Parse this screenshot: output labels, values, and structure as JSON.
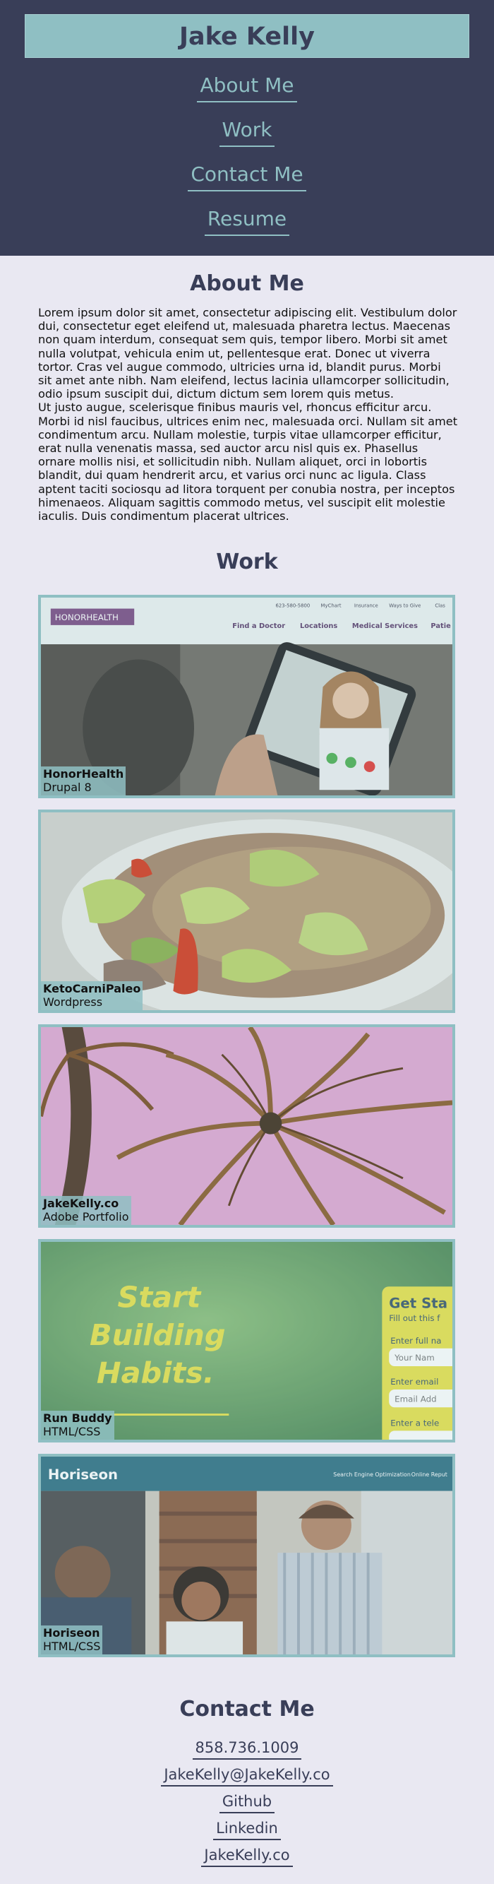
{
  "header": {
    "title": "Jake Kelly"
  },
  "nav": {
    "items": [
      {
        "label": "About Me"
      },
      {
        "label": "Work"
      },
      {
        "label": "Contact Me"
      },
      {
        "label": "Resume"
      }
    ]
  },
  "about": {
    "title": "About Me",
    "paragraph1": "Lorem ipsum dolor sit amet, consectetur adipiscing elit. Vestibulum dolor dui, consectetur eget eleifend ut, malesuada pharetra lectus. Maecenas non quam interdum, consequat sem quis, tempor libero. Morbi sit amet nulla volutpat, vehicula enim ut, pellentesque erat. Donec ut viverra tortor. Cras vel augue commodo, ultricies urna id, blandit purus. Morbi sit amet ante nibh. Nam eleifend, lectus lacinia ullamcorper sollicitudin, odio ipsum suscipit dui, dictum dictum sem lorem quis metus.",
    "paragraph2": "Ut justo augue, scelerisque finibus mauris vel, rhoncus efficitur arcu. Morbi id nisl faucibus, ultrices enim nec, malesuada orci. Nullam sit amet condimentum arcu. Nullam molestie, turpis vitae ullamcorper efficitur, erat nulla venenatis massa, sed auctor arcu nisl quis ex. Phasellus ornare mollis nisi, et sollicitudin nibh. Nullam aliquet, orci in lobortis blandit, dui quam hendrerit arcu, et varius orci nunc ac ligula. Class aptent taciti sociosqu ad litora torquent per conubia nostra, per inceptos himenaeos. Aliquam sagittis commodo metus, vel suscipit elit molestie iaculis. Duis condimentum placerat ultrices."
  },
  "work": {
    "title": "Work",
    "projects": [
      {
        "name": "HonorHealth",
        "tech": "Drupal 8",
        "screenshot": {
          "logo": "HONORHEALTH",
          "top_links": [
            "623-580-5800",
            "MyChart",
            "Insurance",
            "Ways to Give",
            "Clas"
          ],
          "menu": [
            "Find a Doctor",
            "Locations",
            "Medical Services",
            "Patie"
          ]
        }
      },
      {
        "name": "KetoCarniPaleo",
        "tech": "Wordpress"
      },
      {
        "name": "JakeKelly.co",
        "tech": "Adobe Portfolio"
      },
      {
        "name": "Run Buddy",
        "tech": "HTML/CSS",
        "screenshot": {
          "headline": [
            "Start",
            "Building",
            "Habits."
          ],
          "form_title": "Get Sta",
          "form_subtitle": "Fill out this f",
          "fields": [
            {
              "label": "Enter full na",
              "placeholder": "Your Nam"
            },
            {
              "label": "Enter email",
              "placeholder": "Email Add"
            },
            {
              "label": "Enter a tele"
            }
          ]
        }
      },
      {
        "name": "Horiseon",
        "tech": "HTML/CSS",
        "screenshot": {
          "brand": "Horiseon",
          "menu": [
            "Search Engine Optimization",
            "Online Reput"
          ]
        }
      }
    ]
  },
  "contact": {
    "title": "Contact Me",
    "items": [
      {
        "label": "858.736.1009"
      },
      {
        "label": "JakeKelly@JakeKelly.co"
      },
      {
        "label": "Github"
      },
      {
        "label": "Linkedin"
      },
      {
        "label": "JakeKelly.co"
      }
    ]
  },
  "colors": {
    "header_bg": "#393e58",
    "accent": "#8fbfc3",
    "page_bg": "#e9e8f2"
  }
}
